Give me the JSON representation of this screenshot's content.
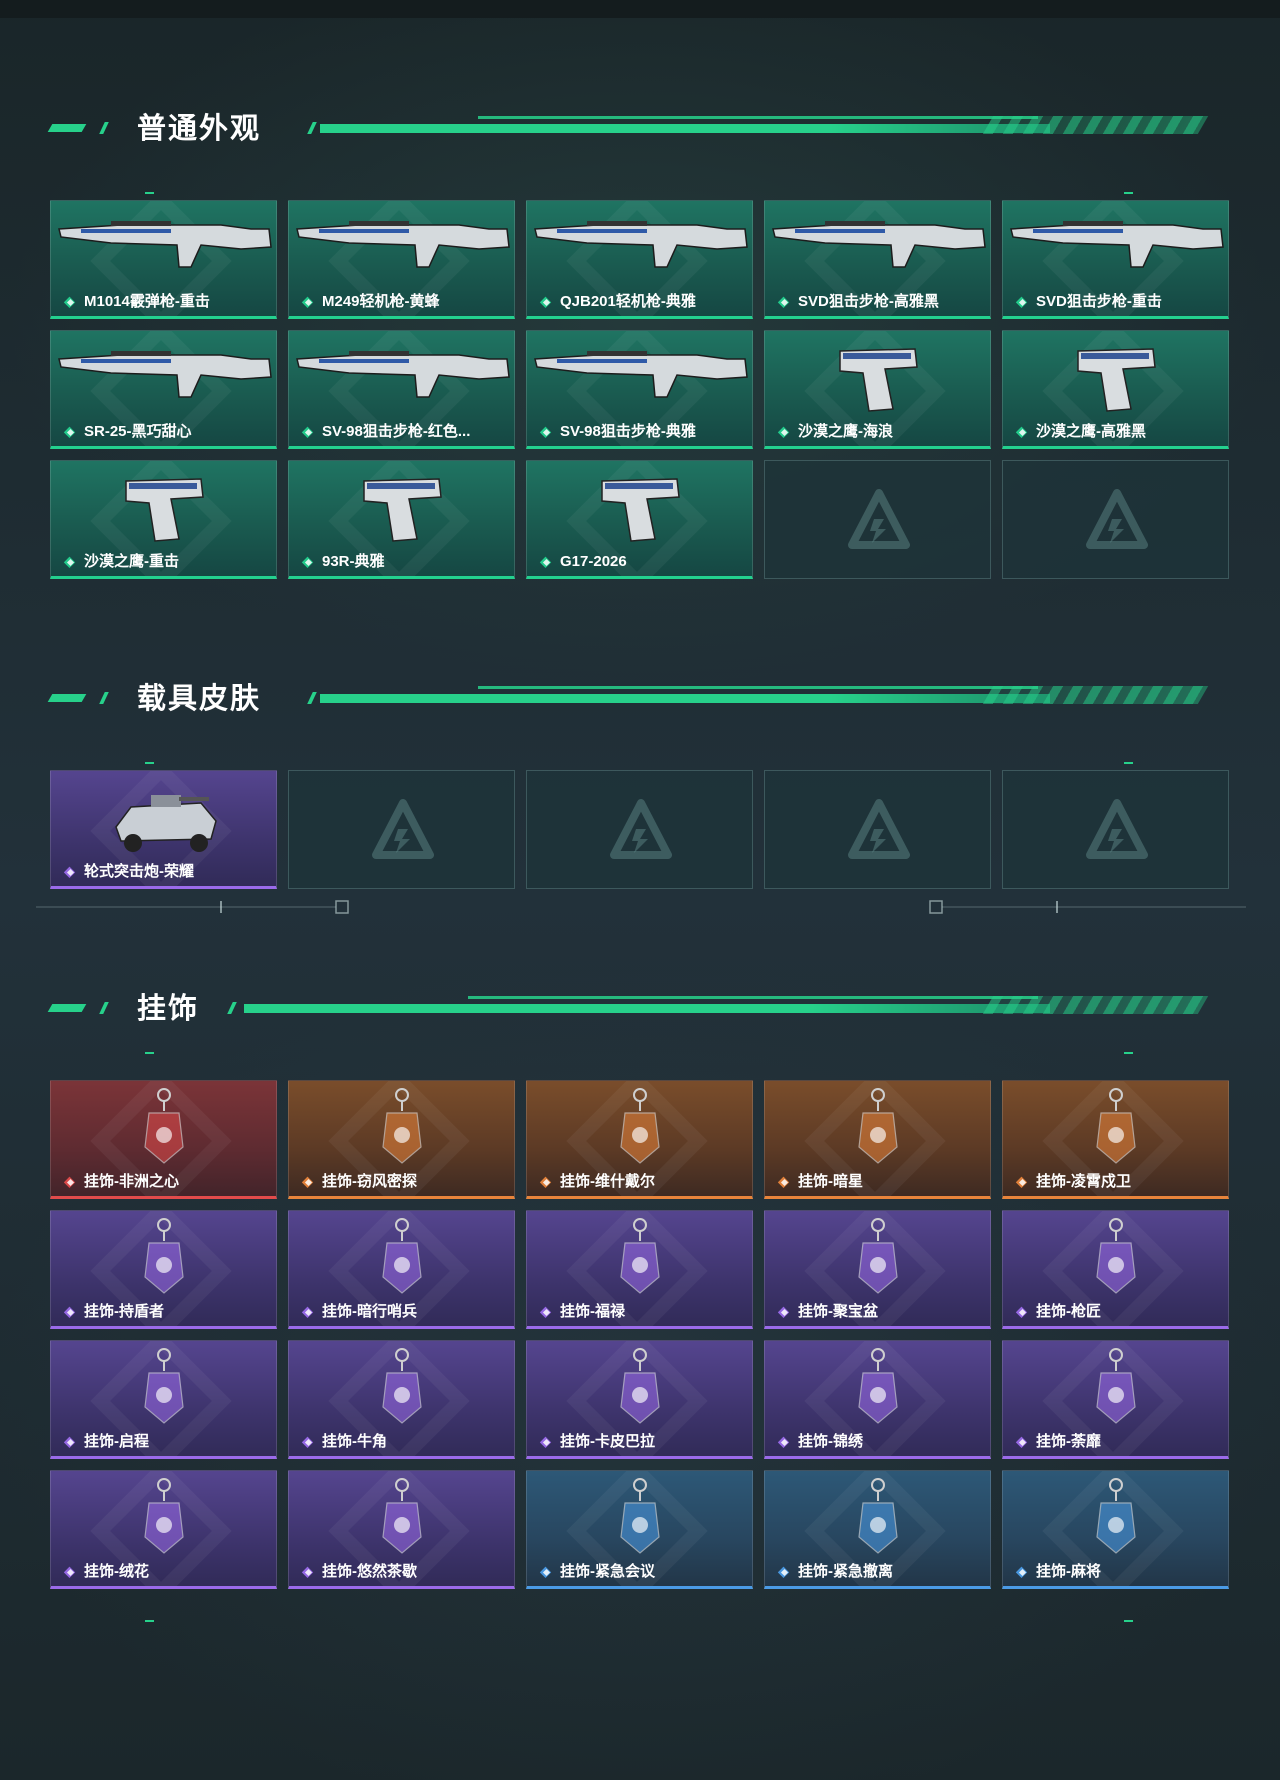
{
  "sections": {
    "weapon_skins": {
      "title": "普通外观",
      "items": [
        {
          "label": "M1014霰弹枪-重击",
          "rarity": "green",
          "icon": "shotgun-icon"
        },
        {
          "label": "M249轻机枪-黄蜂",
          "rarity": "green",
          "icon": "machine-gun-icon"
        },
        {
          "label": "QJB201轻机枪-典雅",
          "rarity": "green",
          "icon": "machine-gun-icon"
        },
        {
          "label": "SVD狙击步枪-高雅黑",
          "rarity": "green",
          "icon": "sniper-rifle-icon"
        },
        {
          "label": "SVD狙击步枪-重击",
          "rarity": "green",
          "icon": "sniper-rifle-icon"
        },
        {
          "label": "SR-25-黑巧甜心",
          "rarity": "green",
          "icon": "rifle-icon"
        },
        {
          "label": "SV-98狙击步枪-红色...",
          "rarity": "green",
          "icon": "sniper-rifle-icon"
        },
        {
          "label": "SV-98狙击步枪-典雅",
          "rarity": "green",
          "icon": "sniper-rifle-icon"
        },
        {
          "label": "沙漠之鹰-海浪",
          "rarity": "green",
          "icon": "pistol-icon"
        },
        {
          "label": "沙漠之鹰-高雅黑",
          "rarity": "green",
          "icon": "pistol-icon"
        },
        {
          "label": "沙漠之鹰-重击",
          "rarity": "green",
          "icon": "pistol-icon"
        },
        {
          "label": "93R-典雅",
          "rarity": "green",
          "icon": "pistol-icon"
        },
        {
          "label": "G17-2026",
          "rarity": "green",
          "icon": "pistol-icon"
        }
      ],
      "empty_slots": 2
    },
    "vehicle_skins": {
      "title": "载具皮肤",
      "items": [
        {
          "label": "轮式突击炮-荣耀",
          "rarity": "purple",
          "icon": "armored-vehicle-icon"
        }
      ],
      "empty_slots": 4
    },
    "charms": {
      "title": "挂饰",
      "items": [
        {
          "label": "挂饰-非洲之心",
          "rarity": "red",
          "icon": "gem-charm-icon"
        },
        {
          "label": "挂饰-窃风密探",
          "rarity": "orange",
          "icon": "figure-charm-icon"
        },
        {
          "label": "挂饰-维什戴尔",
          "rarity": "orange",
          "icon": "tag-charm-icon"
        },
        {
          "label": "挂饰-暗星",
          "rarity": "orange",
          "icon": "feather-charm-icon"
        },
        {
          "label": "挂饰-凌霄戍卫",
          "rarity": "orange",
          "icon": "figure-charm-icon"
        },
        {
          "label": "挂饰-持盾者",
          "rarity": "purple",
          "icon": "shield-charm-icon"
        },
        {
          "label": "挂饰-暗行哨兵",
          "rarity": "purple",
          "icon": "figure-charm-icon"
        },
        {
          "label": "挂饰-福禄",
          "rarity": "purple",
          "icon": "gourd-charm-icon"
        },
        {
          "label": "挂饰-聚宝盆",
          "rarity": "purple",
          "icon": "treasure-bowl-charm-icon"
        },
        {
          "label": "挂饰-枪匠",
          "rarity": "purple",
          "icon": "toolbox-charm-icon"
        },
        {
          "label": "挂饰-启程",
          "rarity": "purple",
          "icon": "ring-charm-icon"
        },
        {
          "label": "挂饰-牛角",
          "rarity": "purple",
          "icon": "horns-charm-icon"
        },
        {
          "label": "挂饰-卡皮巴拉",
          "rarity": "purple",
          "icon": "capybara-charm-icon"
        },
        {
          "label": "挂饰-锦绣",
          "rarity": "purple",
          "icon": "butterfly-charm-icon"
        },
        {
          "label": "挂饰-荼靡",
          "rarity": "purple",
          "icon": "flower-charm-icon"
        },
        {
          "label": "挂饰-绒花",
          "rarity": "purple",
          "icon": "rose-charm-icon"
        },
        {
          "label": "挂饰-悠然茶歇",
          "rarity": "purple",
          "icon": "cupcake-charm-icon"
        },
        {
          "label": "挂饰-紧急会议",
          "rarity": "blue",
          "icon": "figure-charm-icon"
        },
        {
          "label": "挂饰-紧急撤离",
          "rarity": "blue",
          "icon": "tag-charm-icon"
        },
        {
          "label": "挂饰-麻将",
          "rarity": "blue",
          "icon": "mahjong-tile-charm-icon"
        }
      ],
      "empty_slots": 0
    }
  },
  "colors": {
    "accent": "#27d18b",
    "green": "#23d18f",
    "purple": "#9b6bea",
    "red": "#e24b4b",
    "orange": "#e8843b",
    "blue": "#4b9be6"
  }
}
